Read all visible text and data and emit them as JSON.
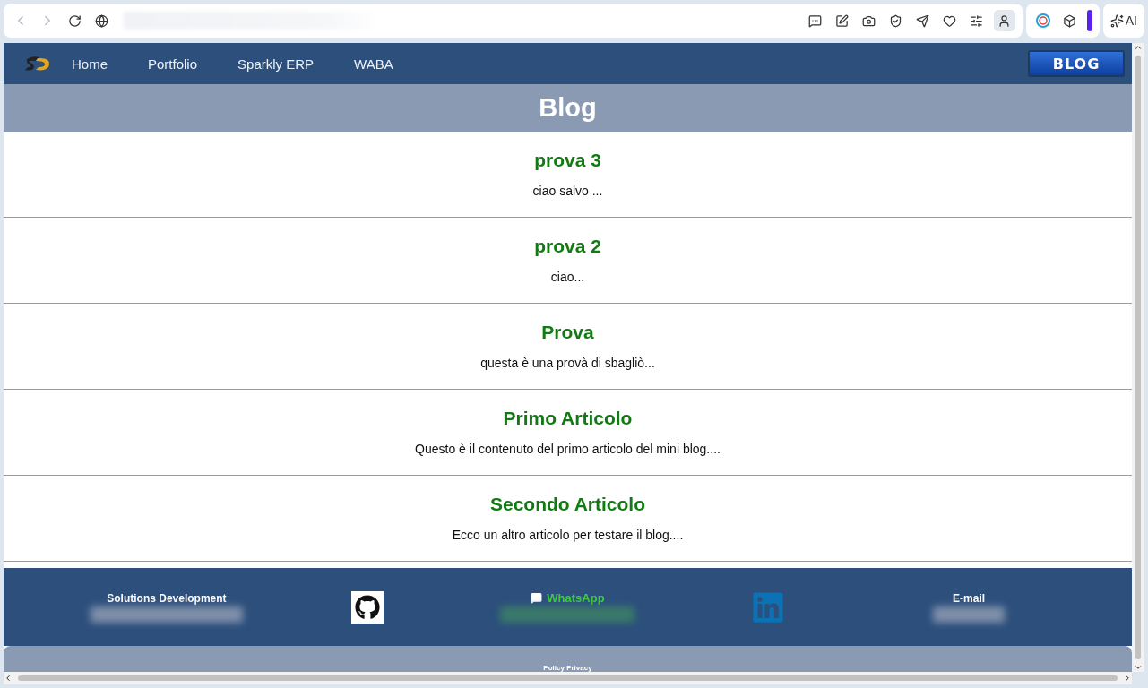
{
  "browser": {
    "ai_button": "AI"
  },
  "nav": {
    "items": [
      {
        "label": "Home"
      },
      {
        "label": "Portfolio"
      },
      {
        "label": "Sparkly ERP"
      },
      {
        "label": "WABA"
      }
    ],
    "blog_button": "BLOG"
  },
  "page_title": "Blog",
  "posts": [
    {
      "title": "prova 3",
      "excerpt": "ciao salvo ..."
    },
    {
      "title": "prova 2",
      "excerpt": "ciao..."
    },
    {
      "title": "Prova",
      "excerpt": "questa è una provà di sbagliò..."
    },
    {
      "title": "Primo Articolo",
      "excerpt": "Questo è il contenuto del primo articolo del mini blog...."
    },
    {
      "title": "Secondo Articolo",
      "excerpt": "Ecco un altro articolo per testare il blog...."
    }
  ],
  "footer": {
    "items": [
      {
        "kind": "text",
        "label": "Solutions Development"
      },
      {
        "kind": "github"
      },
      {
        "kind": "whatsapp",
        "label": "WhatsApp"
      },
      {
        "kind": "linkedin"
      },
      {
        "kind": "text",
        "label": "E-mail"
      }
    ],
    "policy_link": "Policy Privacy"
  }
}
